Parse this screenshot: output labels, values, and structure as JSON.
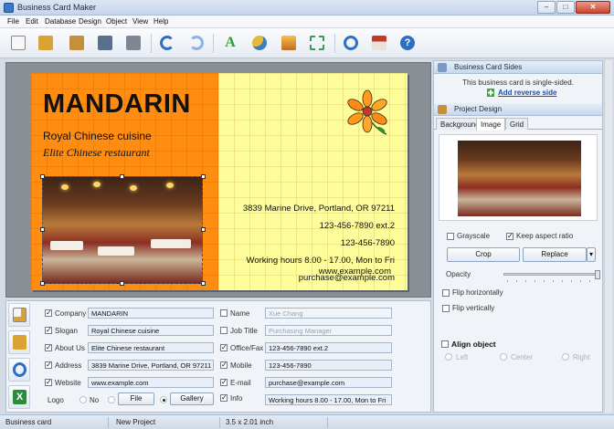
{
  "window": {
    "title": "Business Card Maker"
  },
  "menu": [
    "File",
    "Edit",
    "Database",
    "Design",
    "Object",
    "View",
    "Help"
  ],
  "toolbar": {
    "buttons": [
      "new-icon",
      "open-icon",
      "clipboard-icon",
      "save-icon",
      "print-icon",
      "undo-icon",
      "redo-icon",
      "text-icon",
      "shapes-icon",
      "image-icon",
      "fit-icon",
      "zoom-icon",
      "home-icon",
      "help-icon"
    ],
    "colors": {
      "new": "#f5f5f5",
      "open": "#d9a233",
      "clipboard": "#c58f3b",
      "save": "#5a6f8c",
      "print": "#7d8894",
      "undo": "#2f6fc1",
      "redo": "#8fb3e0",
      "text": "#2e9a3c",
      "shapes": "#e8b83a",
      "image": "#c06a1f",
      "fit": "#3a9c4a",
      "zoom": "#2f6fc1",
      "home": "#c0392b",
      "help": "#2f6fc1"
    }
  },
  "card": {
    "company": "MANDARIN",
    "slogan": "Royal Chinese cuisine",
    "about": "Elite Chinese restaurant",
    "address": "3839 Marine Drive, Portland, OR 97211",
    "office": "123-456-7890 ext.2",
    "mobile": "123-456-7890",
    "info": "Working hours 8.00 - 17.00, Mon to Fri",
    "email": "purchase@example.com",
    "website": "www.example.com",
    "colors": {
      "left": "#ff8d12",
      "right": "#fdfd9c"
    }
  },
  "sides_panel": {
    "title": "Business Card Sides",
    "message": "This business card is single-sided.",
    "add_link": "Add reverse side"
  },
  "design_panel": {
    "title": "Project Design",
    "tabs": [
      "Background",
      "Image",
      "Grid"
    ],
    "active_tab": "Image",
    "grayscale_label": "Grayscale",
    "grayscale_checked": false,
    "keep_aspect_label": "Keep aspect ratio",
    "keep_aspect_checked": true,
    "crop_label": "Crop",
    "replace_label": "Replace",
    "opacity_label": "Opacity",
    "opacity_value": 1.0,
    "flip_h_label": "Flip horizontally",
    "flip_v_label": "Flip vertically",
    "align_label": "Align object",
    "align_options": [
      "Left",
      "Center",
      "Right"
    ]
  },
  "form": {
    "left": [
      {
        "label": "Company",
        "value": "MANDARIN",
        "checked": true
      },
      {
        "label": "Slogan",
        "value": "Royal Chinese cuisine",
        "checked": true
      },
      {
        "label": "About Us",
        "value": "Elite Chinese restaurant",
        "checked": true
      },
      {
        "label": "Address",
        "value": "3839 Marine Drive, Portland, OR 97211",
        "checked": true
      },
      {
        "label": "Website",
        "value": "www.example.com",
        "checked": true
      }
    ],
    "right": [
      {
        "label": "Name",
        "value": "Xue Chang",
        "checked": false
      },
      {
        "label": "Job Title",
        "value": "Purchasing Manager",
        "checked": false
      },
      {
        "label": "Office/Fax",
        "value": "123-456-7890 ext.2",
        "checked": true
      },
      {
        "label": "Mobile",
        "value": "123-456-7890",
        "checked": true
      },
      {
        "label": "E-mail",
        "value": "purchase@example.com",
        "checked": true
      },
      {
        "label": "Info",
        "value": "Working hours 8.00 - 17.00, Mon to Fri",
        "checked": true
      }
    ],
    "logo_label": "Logo",
    "logo_no": "No",
    "logo_file": "File",
    "logo_gallery": "Gallery",
    "logo_selected": "Gallery"
  },
  "sidebuttons": [
    "edit-icon",
    "book-icon",
    "search-user-icon",
    "excel-icon"
  ],
  "status": {
    "left": "Business card",
    "project": "New Project",
    "size": "3.5 x 2.01 inch"
  }
}
